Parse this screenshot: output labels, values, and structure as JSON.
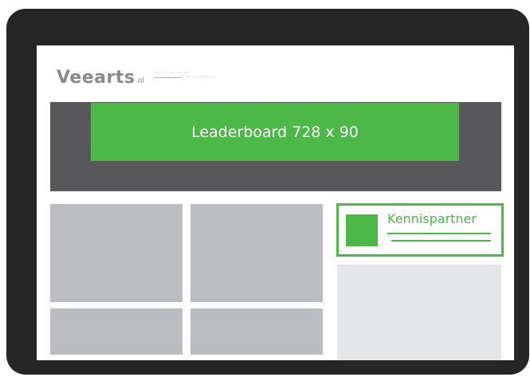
{
  "site": {
    "logo_text": "Veearts",
    "logo_suffix": ".nl",
    "logo_tagline_top": "~ ~~ ~ ~~ ~~ ~~",
    "logo_tagline_bottom": "~~ ~~~ ~~~~~~"
  },
  "ads": {
    "leaderboard_label": "Leaderboard 728 x 90",
    "kennispartner_label": "Kennispartner"
  },
  "colors": {
    "frame": "#262626",
    "header_band": "#58585a",
    "accent_green": "#4cb848",
    "tile_gray": "#bcbdc0",
    "side_panel": "#e6e7e8"
  }
}
